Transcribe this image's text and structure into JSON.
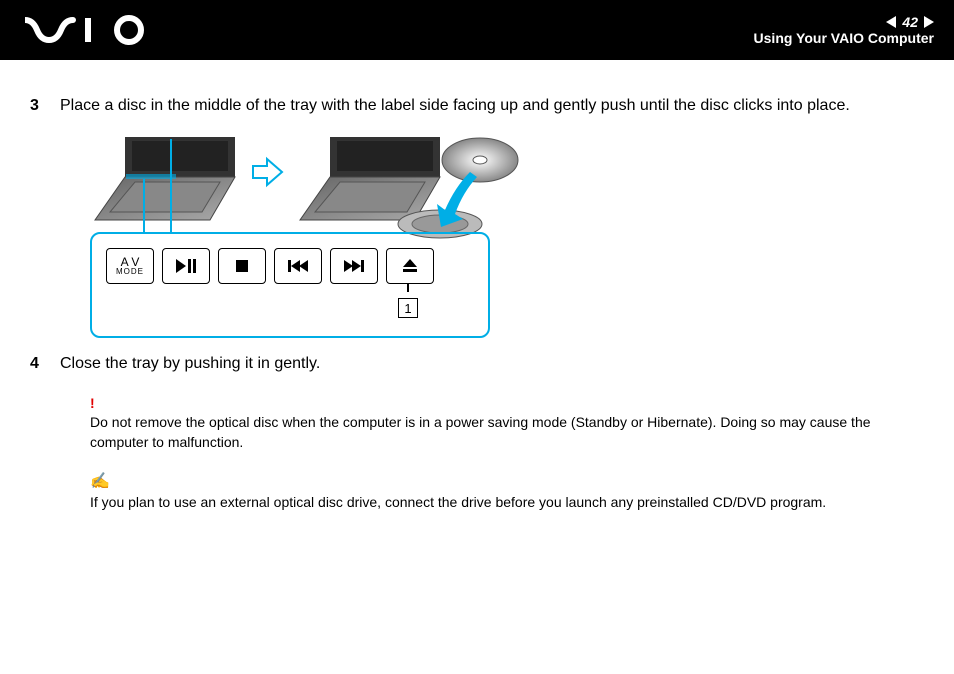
{
  "header": {
    "page_number": "42",
    "section": "Using Your VAIO Computer"
  },
  "steps": {
    "s3_num": "3",
    "s3_text": "Place a disc in the middle of the tray with the label side facing up and gently push until the disc clicks into place.",
    "s4_num": "4",
    "s4_text": "Close the tray by pushing it in gently."
  },
  "keys": {
    "av_top": "A V",
    "av_sub": "MODE",
    "marker": "1"
  },
  "notes": {
    "warn_icon": "!",
    "warn_text": "Do not remove the optical disc when the computer is in a power saving mode (Standby or Hibernate). Doing so may cause the computer to malfunction.",
    "tip_icon": "✍",
    "tip_text": "If you plan to use an external optical disc drive, connect the drive before you launch any preinstalled CD/DVD program."
  }
}
